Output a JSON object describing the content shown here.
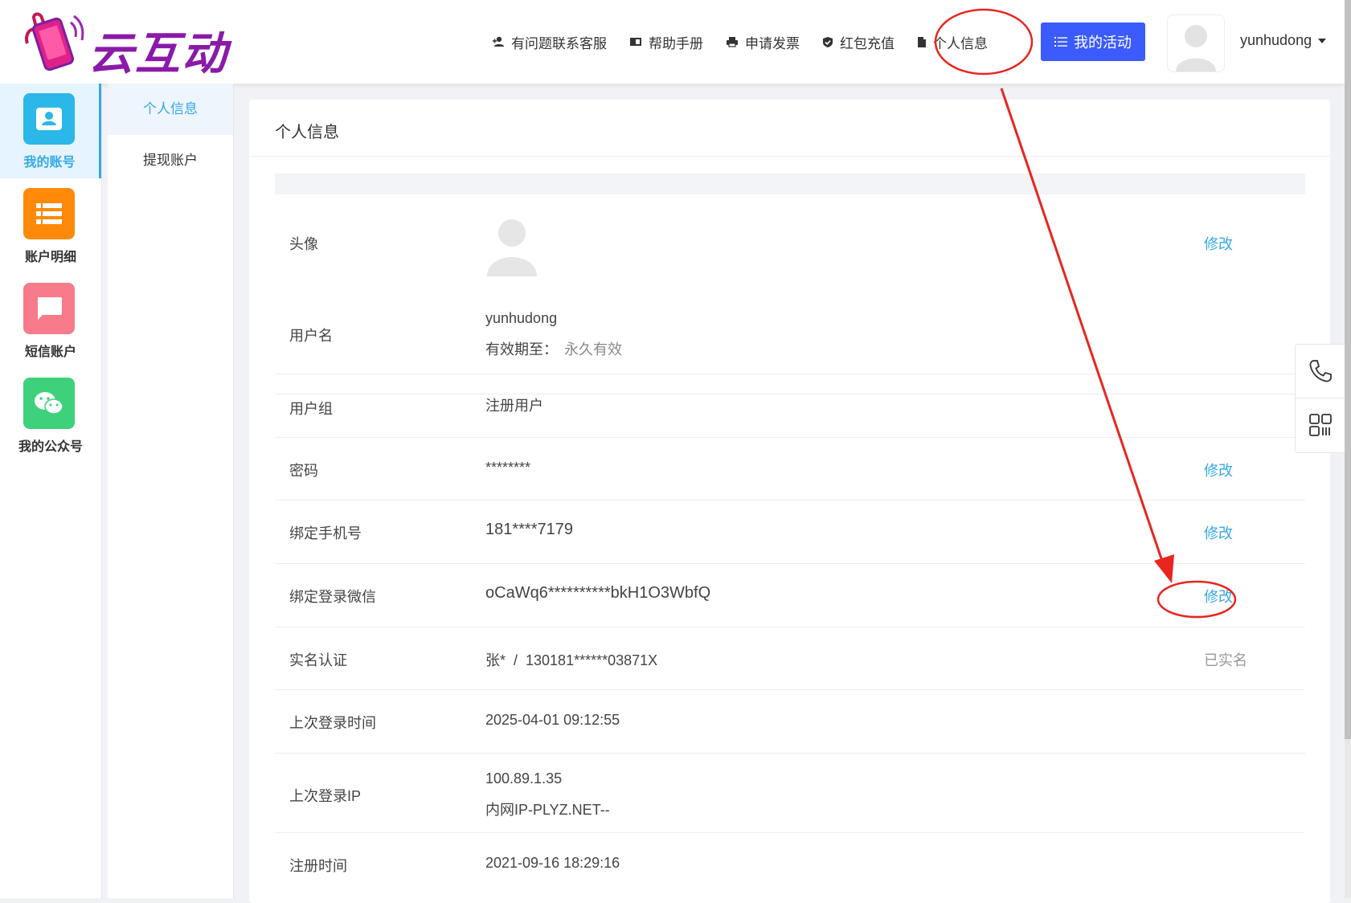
{
  "brand": {
    "name": "云互动"
  },
  "header": {
    "nav": [
      {
        "label": "有问题联系客服",
        "icon": "user-plus-icon"
      },
      {
        "label": "帮助手册",
        "icon": "book-icon"
      },
      {
        "label": "申请发票",
        "icon": "printer-icon"
      },
      {
        "label": "红包充值",
        "icon": "shield-check-icon"
      },
      {
        "label": "个人信息",
        "icon": "document-icon"
      }
    ],
    "activity_button": "我的活动",
    "username": "yunhudong"
  },
  "sidebar": {
    "items": [
      {
        "label": "我的账号",
        "icon": "account-card-icon",
        "color": "#2bb7e8",
        "active": true
      },
      {
        "label": "账户明细",
        "icon": "list-icon",
        "color": "#ff8a0a",
        "active": false
      },
      {
        "label": "短信账户",
        "icon": "chat-bubble-icon",
        "color": "#f77b8a",
        "active": false
      },
      {
        "label": "我的公众号",
        "icon": "wechat-icon",
        "color": "#3ed17c",
        "active": false
      }
    ]
  },
  "submenu": {
    "items": [
      {
        "label": "个人信息",
        "active": true
      },
      {
        "label": "提现账户",
        "active": false
      }
    ]
  },
  "main": {
    "title": "个人信息",
    "rows": {
      "avatar": {
        "label": "头像",
        "action": "修改"
      },
      "username": {
        "label": "用户名",
        "value": "yunhudong",
        "expiry_label": "有效期至：",
        "expiry_value": "永久有效"
      },
      "group": {
        "label": "用户组",
        "value": "注册用户"
      },
      "password": {
        "label": "密码",
        "value": "********",
        "action": "修改"
      },
      "phone": {
        "label": "绑定手机号",
        "value": "181****7179",
        "action": "修改"
      },
      "wechat": {
        "label": "绑定登录微信",
        "value": "oCaWq6**********bkH1O3WbfQ",
        "action": "修改"
      },
      "realname": {
        "label": "实名认证",
        "value": "张*  /  130181******03871X",
        "status": "已实名"
      },
      "last_login_time": {
        "label": "上次登录时间",
        "value": "2025-04-01 09:12:55"
      },
      "last_login_ip": {
        "label": "上次登录IP",
        "value": "100.89.1.35",
        "value2": "内网IP-PLYZ.NET--"
      },
      "register_time": {
        "label": "注册时间",
        "value": "2021-09-16 18:29:16"
      }
    }
  },
  "colors": {
    "accent": "#35a8e8",
    "activity_button": "#3b5bfd",
    "annotation": "#e8261f"
  },
  "float_tools": [
    {
      "icon": "phone-icon"
    },
    {
      "icon": "qrcode-icon"
    }
  ]
}
